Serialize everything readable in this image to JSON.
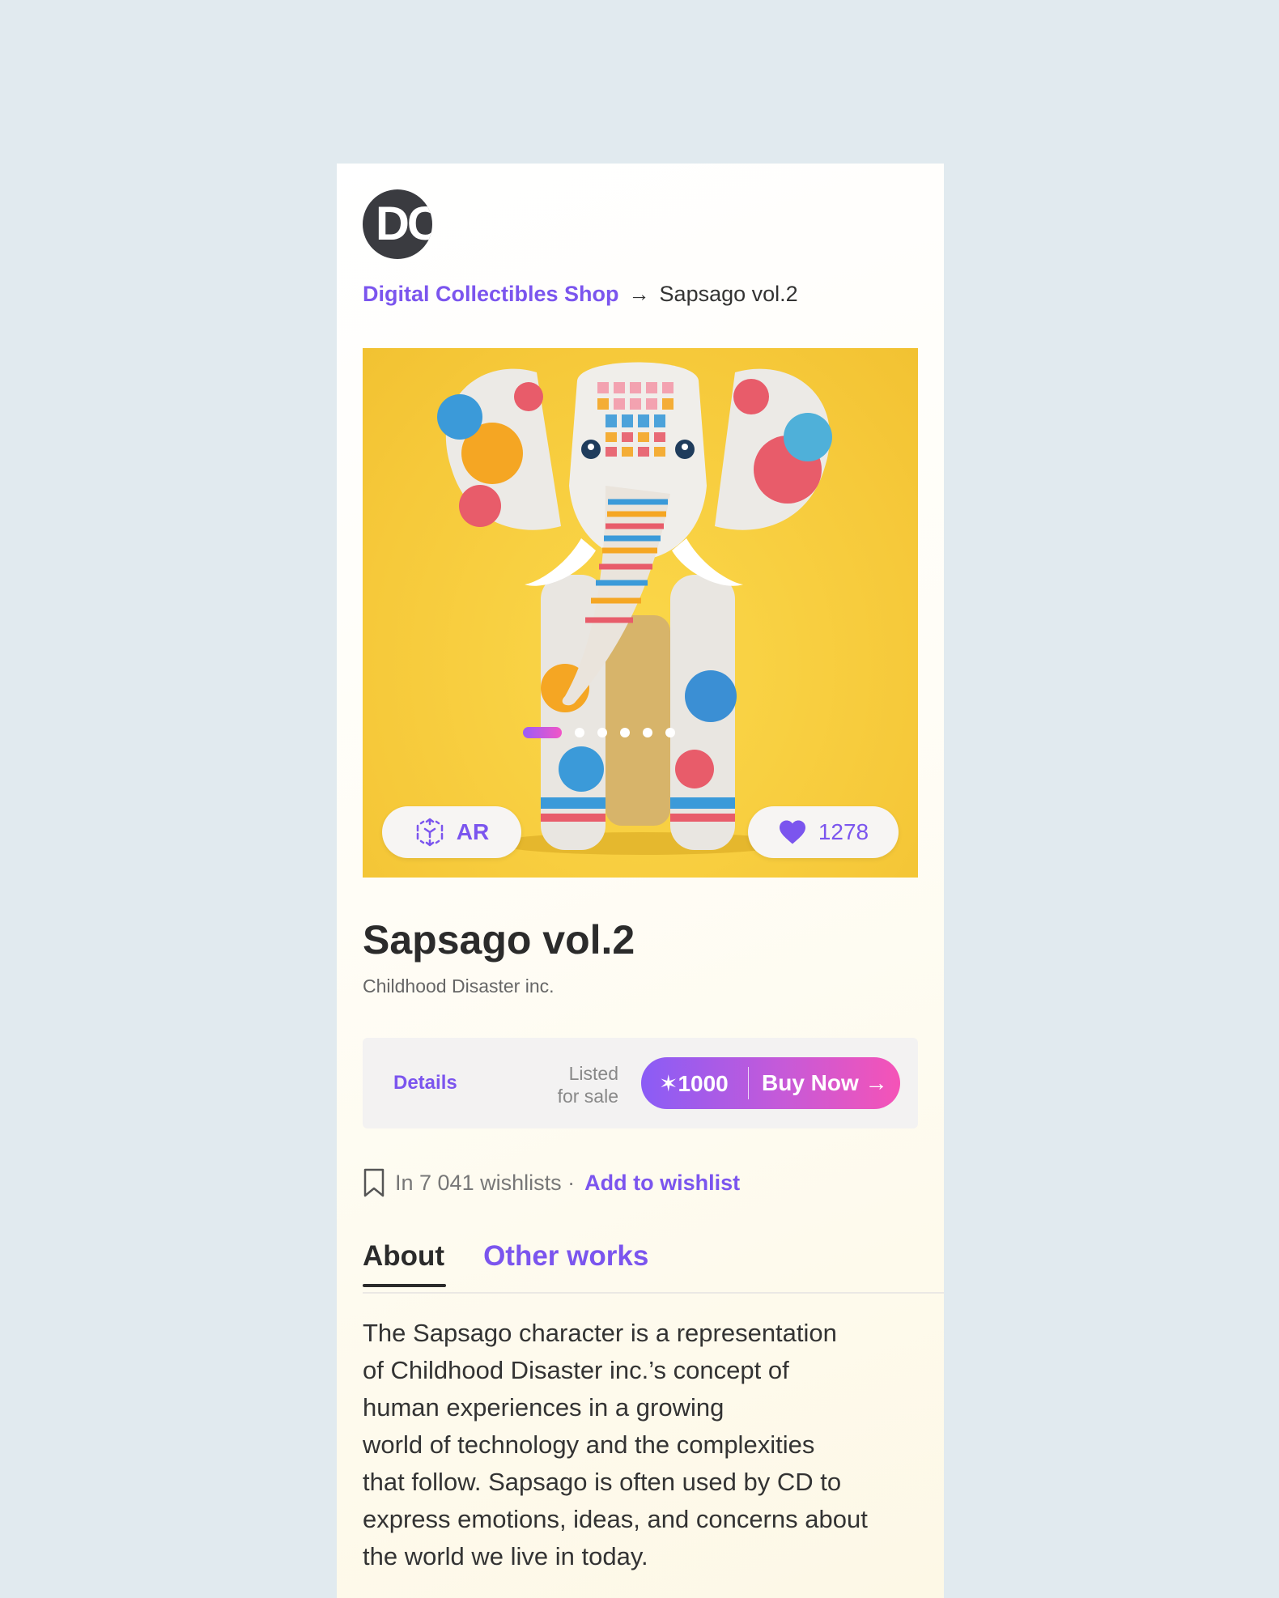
{
  "shop": {
    "logo_text": "DC",
    "name": "Digital Collectibles Shop",
    "breadcrumb_arrow": "→",
    "current": "Sapsago vol.2"
  },
  "hero": {
    "ar_label": "AR",
    "likes": "1278",
    "carousel": {
      "total": 6,
      "active_index": 0
    }
  },
  "item": {
    "title": "Sapsago vol.2",
    "creator": "Childhood Disaster inc."
  },
  "purchase": {
    "details_label": "Details",
    "listed_line1": "Listed",
    "listed_line2": "for sale",
    "price": "✶1000",
    "buy_label": "Buy Now →"
  },
  "wishlist": {
    "count_text": "In 7 041 wishlists ·",
    "add_label": "Add to wishlist"
  },
  "tabs": {
    "about": "About",
    "other": "Other works"
  },
  "about_text": {
    "line1": "The Sapsago character is a representation",
    "line2": "of Childhood Disaster inc.’s concept of",
    "line3": "human experiences in a growing",
    "line4": "world of technology and the complexities",
    "line5": "that follow. Sapsago is often used by CD to",
    "line6": "express emotions, ideas, and concerns about",
    "line7": "the world we live in today."
  },
  "colors": {
    "accent": "#7b55ee",
    "gradient_start": "#8a5cf6",
    "gradient_end": "#f553b7",
    "hero_bg": "#f6c93a",
    "page_bg": "#e1eaef"
  }
}
